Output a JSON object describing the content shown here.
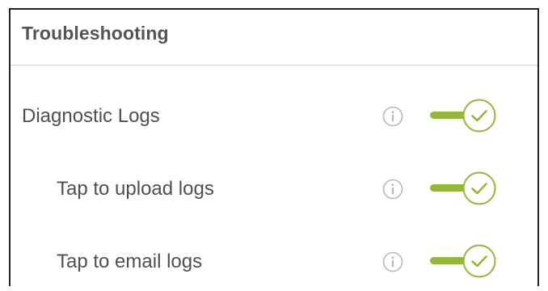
{
  "section": {
    "title": "Troubleshooting"
  },
  "rows": [
    {
      "label": "Diagnostic Logs",
      "toggle_on": true
    },
    {
      "label": "Tap to upload logs",
      "toggle_on": true
    },
    {
      "label": "Tap to email logs",
      "toggle_on": true
    }
  ],
  "icons": {
    "info": "info-circle-icon",
    "toggle_knob": "checkmark-icon"
  },
  "colors": {
    "toggle_accent": "#93b73a",
    "info_icon": "#b8b8b8",
    "text": "#4f4f4f",
    "title": "#555555"
  }
}
